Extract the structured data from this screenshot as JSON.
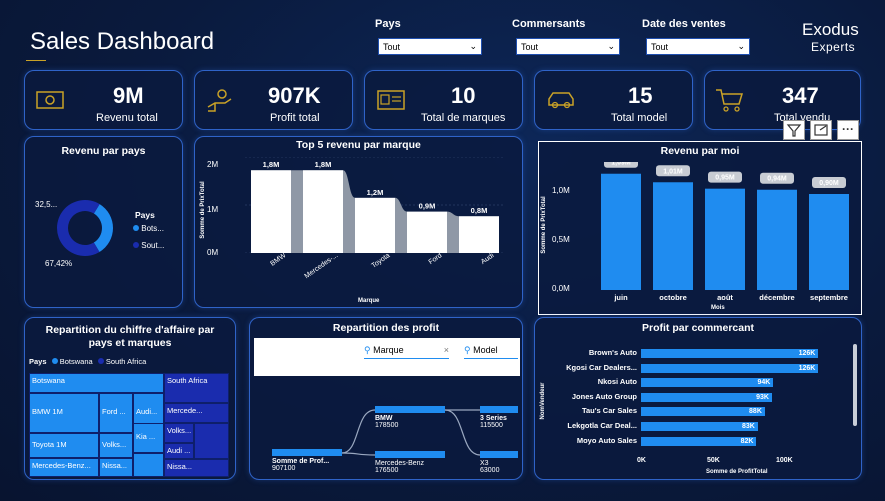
{
  "header": {
    "title": "Sales Dashboard",
    "brand_line1": "Exodus",
    "brand_line2": "Experts"
  },
  "filters": [
    {
      "label": "Pays",
      "value": "Tout"
    },
    {
      "label": "Commersants",
      "value": "Tout"
    },
    {
      "label": "Date des ventes",
      "value": "Tout"
    }
  ],
  "kpis": [
    {
      "value": "9M",
      "label": "Revenu total",
      "icon": "money-icon"
    },
    {
      "value": "907K",
      "label": "Profit total",
      "icon": "hand-coin-icon"
    },
    {
      "value": "10",
      "label": "Total de marques",
      "icon": "id-card-icon"
    },
    {
      "value": "15",
      "label": "Total model",
      "icon": "car-icon"
    },
    {
      "value": "347",
      "label": "Total vendu",
      "icon": "cart-icon"
    }
  ],
  "toolbar": {
    "icons": [
      "filter-icon",
      "focus-mode-icon",
      "more-options-icon"
    ],
    "more_label": "···"
  },
  "donut": {
    "title": "Revenu par pays",
    "legend_title": "Pays",
    "label_top": "32,5...",
    "label_bottom": "67,42%",
    "colors": [
      "#1f8cf0",
      "#1a2cae"
    ],
    "chart_data": {
      "type": "pie",
      "categories": [
        "Bots...",
        "Sout..."
      ],
      "values": [
        32.58,
        67.42
      ]
    }
  },
  "top5": {
    "title": "Top 5 revenu par marque",
    "ylabel": "Somme de PrixTotal",
    "xlabel": "Marque",
    "yticks": [
      "2M",
      "1M",
      "0M"
    ],
    "chart_data": {
      "type": "bar",
      "categories": [
        "BMW",
        "Mercedes-...",
        "Toyota",
        "Ford",
        "Audi"
      ],
      "values": [
        1.8,
        1.8,
        1.2,
        0.9,
        0.8
      ],
      "labels": [
        "1,8M",
        "1,8M",
        "1,2M",
        "0,9M",
        "0,8M"
      ],
      "ylim": [
        0,
        2
      ]
    }
  },
  "monthly": {
    "title": "Revenu par moi",
    "ylabel": "Somme de PrixTotal",
    "xlabel": "Mois",
    "yticks": [
      "1,0M",
      "0,5M",
      "0,0M"
    ],
    "chart_data": {
      "type": "bar",
      "categories": [
        "juin",
        "octobre",
        "août",
        "décembre",
        "septembre"
      ],
      "values": [
        1.09,
        1.01,
        0.95,
        0.94,
        0.9
      ],
      "labels": [
        "1,09M",
        "1,01M",
        "0,95M",
        "0,94M",
        "0,90M"
      ],
      "ylim": [
        0,
        1.2
      ]
    }
  },
  "treemap": {
    "title_line1": "Repartition du chiffre d'affaire par",
    "title_line2": "pays et marques",
    "legend_label": "Pays",
    "legend_items": [
      "Botswana",
      "South Africa"
    ],
    "cells": [
      "Botswana",
      "South Africa",
      "BMW 1M",
      "Ford ...",
      "Audi...",
      "Mercede...",
      "Toyota 1M",
      "Volks...",
      "Kia ...",
      "Volks...",
      "Audi ...",
      "Mercedes-Benz...",
      "Nissa...",
      "Nissa..."
    ]
  },
  "decomp": {
    "title": "Repartition des profit",
    "slicer1": "Marque",
    "slicer2": "Model",
    "clear": "×",
    "root_label": "Somme de Prof...",
    "root_value": "907100",
    "level1": [
      {
        "label": "BMW",
        "value": "178500"
      },
      {
        "label": "Mercedes-Benz",
        "value": "176500"
      }
    ],
    "level2": [
      {
        "label": "3 Series",
        "value": "115500"
      },
      {
        "label": "X3",
        "value": "63000"
      }
    ]
  },
  "profit": {
    "title": "Profit par commercant",
    "ylabel": "NomVendeur",
    "xlabel": "Somme de ProfitTotal",
    "xticks": [
      "0K",
      "50K",
      "100K"
    ],
    "chart_data": {
      "type": "bar",
      "categories": [
        "Brown's Auto",
        "Kgosi Car Dealers...",
        "Nkosi Auto",
        "Jones Auto Group",
        "Tau's Car Sales",
        "Lekgotla Car Deal...",
        "Moyo Auto Sales"
      ],
      "values": [
        126,
        126,
        94,
        93,
        88,
        83,
        82
      ],
      "labels": [
        "126K",
        "126K",
        "94K",
        "93K",
        "88K",
        "83K",
        "82K"
      ],
      "xlim": [
        0,
        130
      ]
    }
  }
}
